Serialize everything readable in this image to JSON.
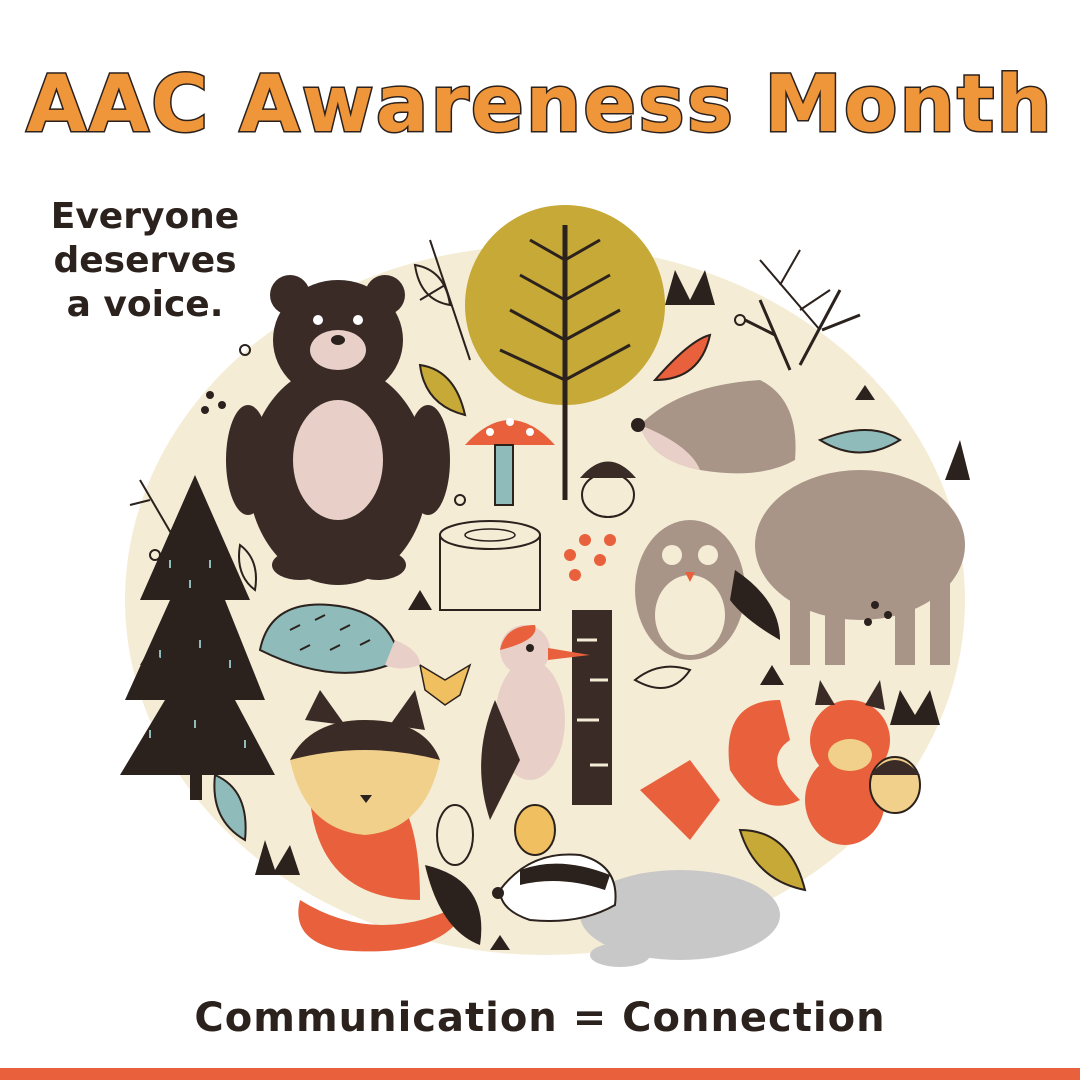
{
  "title": "AAC Awareness Month",
  "tagline": {
    "line1": "Everyone",
    "line2": "deserves",
    "line3": "a voice."
  },
  "footer": "Communication = Connection",
  "colors": {
    "title": "#f0963a",
    "text": "#2b211d",
    "bar": "#e8603c",
    "background": "#ffffff",
    "circle": "#f5ecd6"
  },
  "illustration": {
    "icons": [
      "bear-icon",
      "tree-icon",
      "deer-icon",
      "owl-icon",
      "hedgehog-icon",
      "woodpecker-icon",
      "fox-icon",
      "squirrel-icon",
      "badger-icon",
      "mushroom-icon",
      "acorn-icon",
      "stump-icon",
      "pine-tree-icon",
      "leaf-icon"
    ]
  }
}
